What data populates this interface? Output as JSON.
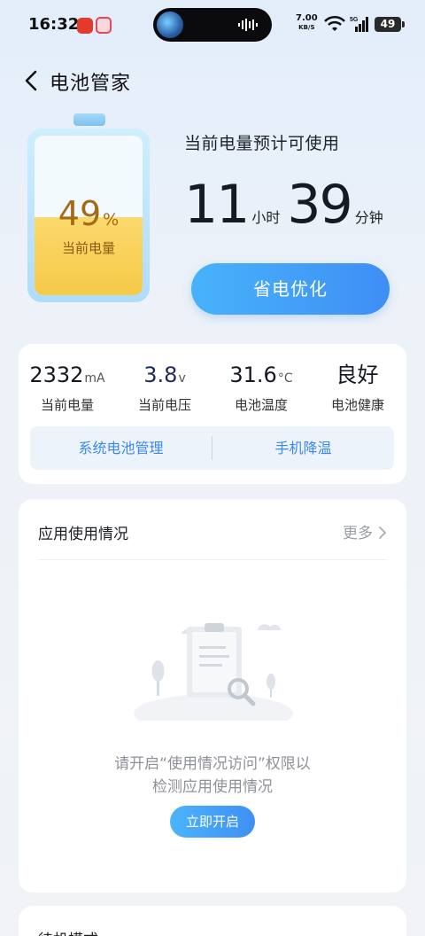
{
  "status_bar": {
    "time": "16:32",
    "net_speed": "7.00",
    "net_speed_unit": "KB/S",
    "network_type": "5G",
    "battery_level": "49"
  },
  "header": {
    "title": "电池管家"
  },
  "battery": {
    "percent": "49",
    "percent_unit": "%",
    "level_fraction": 0.49,
    "label": "当前电量"
  },
  "estimate": {
    "label": "当前电量预计可使用",
    "hours": "11",
    "hours_unit": "小时",
    "minutes": "39",
    "minutes_unit": "分钟"
  },
  "optimize_button": "省电优化",
  "stats": [
    {
      "value": "2332",
      "unit": "mA",
      "label": "当前电量"
    },
    {
      "value": "3.8",
      "unit": "v",
      "label": "当前电压"
    },
    {
      "value": "31.6",
      "unit": "°C",
      "label": "电池温度"
    },
    {
      "value": "良好",
      "unit": "",
      "label": "电池健康"
    }
  ],
  "links": {
    "system_battery": "系统电池管理",
    "cooling": "手机降温"
  },
  "usage": {
    "title": "应用使用情况",
    "more": "更多",
    "empty_line1": "请开启“使用情况访问”权限以",
    "empty_line2": "检测应用使用情况",
    "enable_button": "立即开启"
  },
  "standby": {
    "title": "待机模式"
  },
  "colors": {
    "accent": "#3f8ef5",
    "battery_fill": "#f6c948",
    "battery_text": "#a56a16"
  }
}
